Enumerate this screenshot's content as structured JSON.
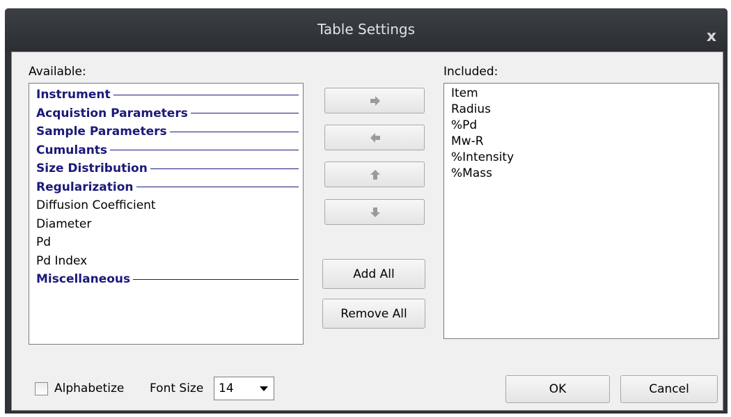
{
  "window": {
    "title": "Table Settings",
    "close_glyph": "x"
  },
  "available": {
    "label": "Available:",
    "items": [
      {
        "text": "Instrument",
        "category": true
      },
      {
        "text": "Acquistion Parameters",
        "category": true
      },
      {
        "text": "Sample Parameters",
        "category": true
      },
      {
        "text": "Cumulants",
        "category": true
      },
      {
        "text": "Size Distribution",
        "category": true
      },
      {
        "text": "Regularization",
        "category": true
      },
      {
        "text": "Diffusion Coefficient",
        "category": false
      },
      {
        "text": "Diameter",
        "category": false
      },
      {
        "text": "Pd",
        "category": false
      },
      {
        "text": "Pd Index",
        "category": false
      },
      {
        "text": "Miscellaneous",
        "category": true
      }
    ]
  },
  "included": {
    "label": "Included:",
    "items": [
      "Item",
      "Radius",
      "%Pd",
      "Mw-R",
      "%Intensity",
      "%Mass"
    ]
  },
  "move_buttons": {
    "right_icon": "arrow-right-icon",
    "left_icon": "arrow-left-icon",
    "up_icon": "arrow-up-icon",
    "down_icon": "arrow-down-icon"
  },
  "actions": {
    "add_all": "Add All",
    "remove_all": "Remove All"
  },
  "footer": {
    "alphabetize_label": "Alphabetize",
    "alphabetize_checked": false,
    "font_size_label": "Font Size",
    "font_size_value": "14",
    "ok": "OK",
    "cancel": "Cancel"
  },
  "colors": {
    "category_text": "#1a1a7a",
    "title_bar": "#2f3236",
    "arrow_icon": "#9a9a9a"
  }
}
